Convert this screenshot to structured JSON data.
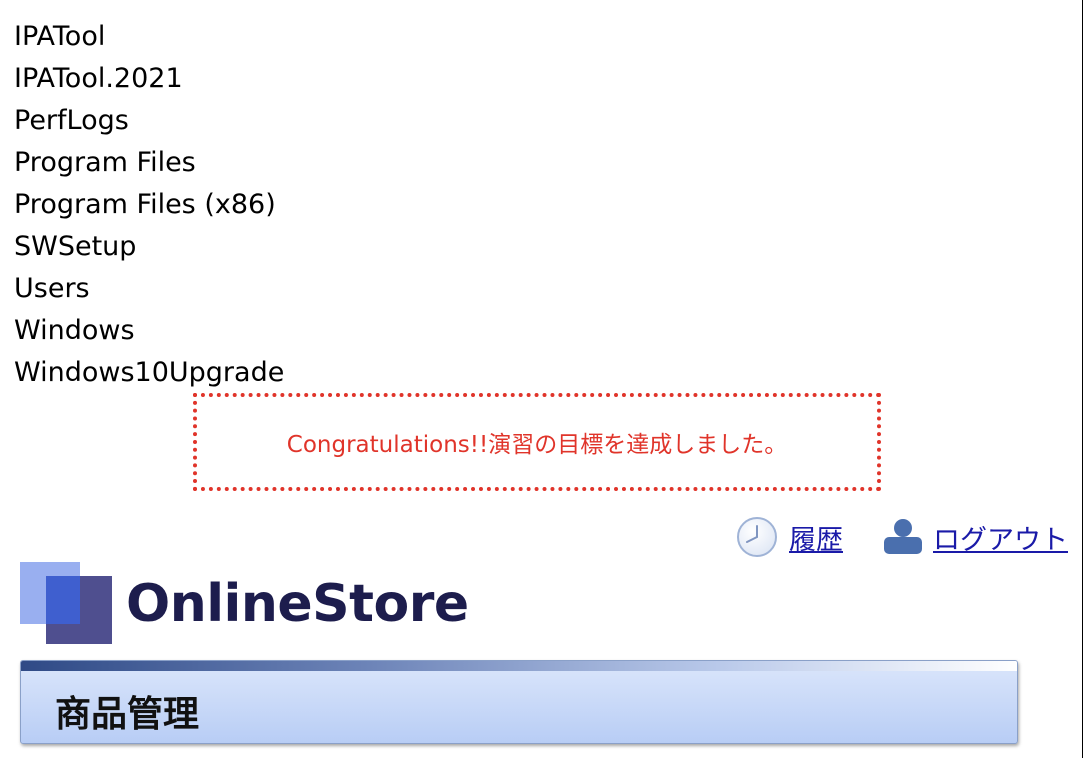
{
  "directory_listing": [
    "IPATool",
    "IPATool.2021",
    "PerfLogs",
    "Program Files",
    "Program Files (x86)",
    "SWSetup",
    "Users",
    "Windows",
    "Windows10Upgrade"
  ],
  "message": {
    "text": "Congratulations!!演習の目標を達成しました。",
    "color": "#e0342a"
  },
  "header": {
    "history_label": "履歴",
    "history_icon": "clock-icon",
    "logout_label": "ログアウト",
    "logout_icon": "user-icon",
    "link_color": "#1a1aa8"
  },
  "brand": {
    "logo_text": "OnlineStore",
    "logo_color": "#1d1d4d"
  },
  "page": {
    "title": "商品管理"
  }
}
